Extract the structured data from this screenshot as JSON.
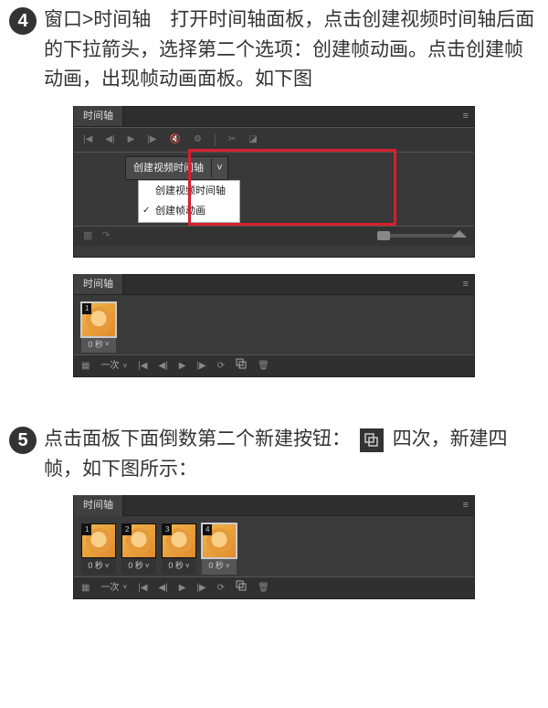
{
  "step4": {
    "number": "4",
    "text": "窗口>时间轴　打开时间轴面板，点击创建视频时间轴后面的下拉箭头，选择第二个选项：创建帧动画。点击创建帧动画，出现帧动画面板。如下图"
  },
  "step5": {
    "number": "5",
    "text_before": "点击面板下面倒数第二个新建按钮：",
    "text_after": "四次，新建四帧，如下图所示："
  },
  "panel_common": {
    "tab_label": "时间轴",
    "loop_label": "一次",
    "frame_time": "0 秒"
  },
  "panel1": {
    "dropdown_label": "创建视频时间轴",
    "menu_item_1": "创建视频时间轴",
    "menu_item_2": "创建帧动画"
  },
  "panel2": {
    "frames": [
      {
        "n": "1",
        "t": "0 秒"
      }
    ]
  },
  "panel3": {
    "frames": [
      {
        "n": "1",
        "t": "0 秒"
      },
      {
        "n": "2",
        "t": "0 秒"
      },
      {
        "n": "3",
        "t": "0 秒"
      },
      {
        "n": "4",
        "t": "0 秒"
      }
    ]
  },
  "colors": {
    "highlight": "#d71f2e",
    "panel_bg": "#3a3a3a"
  }
}
